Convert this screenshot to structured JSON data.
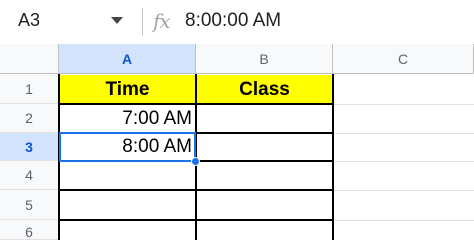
{
  "formula_bar": {
    "name_box": "A3",
    "fx_icon": "function-icon",
    "value": "8:00:00 AM"
  },
  "columns": [
    "A",
    "B",
    "C"
  ],
  "rows": [
    "1",
    "2",
    "3",
    "4",
    "5",
    "6"
  ],
  "cells": {
    "A1": "Time",
    "B1": "Class",
    "A2": "7:00 AM",
    "A3": "8:00 AM"
  },
  "selected_cell": "A3",
  "colors": {
    "header_fill": "#ffff00",
    "selection": "#1a73e8",
    "header_selected_bg": "#d3e3fd"
  }
}
